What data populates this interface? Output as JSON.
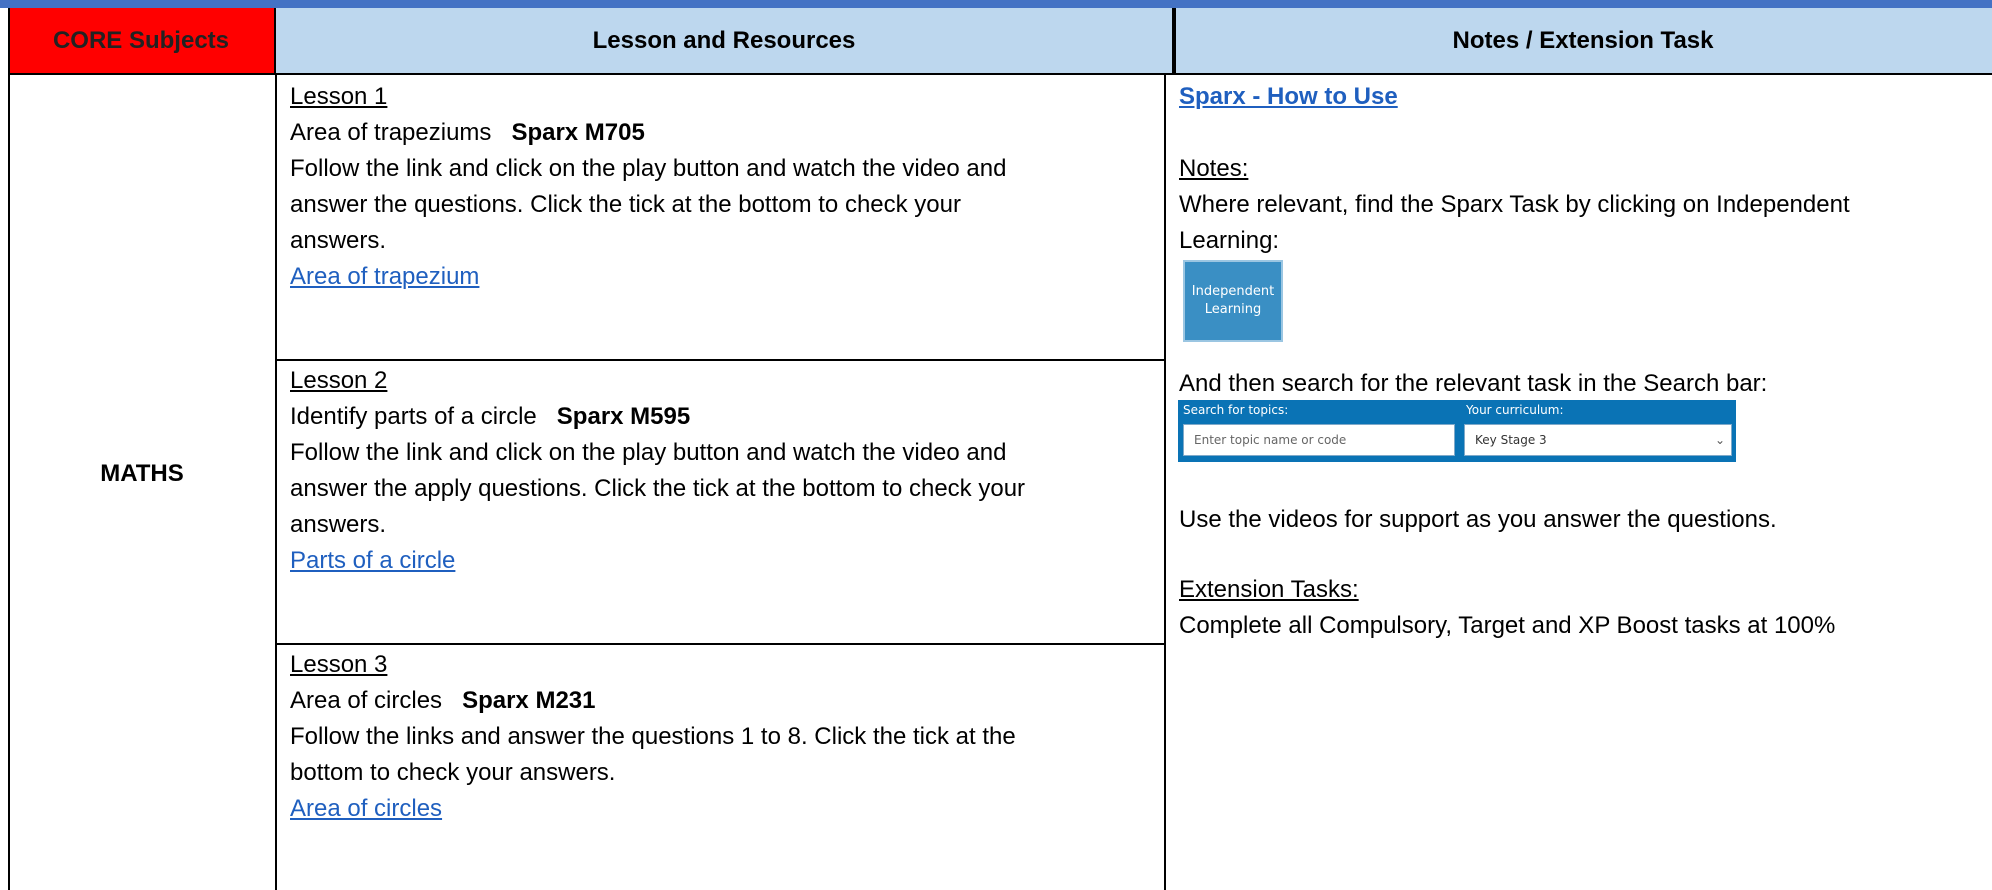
{
  "header": {
    "core": "CORE Subjects",
    "lesson": "Lesson and Resources",
    "notes": "Notes / Extension Task"
  },
  "subject": "MATHS",
  "lessons": [
    {
      "heading": "Lesson 1",
      "topic": "Area of trapeziums",
      "code": "Sparx M705",
      "lines": [
        "Follow the link and click on the play button and watch the video and",
        "answer the questions. Click the tick at the bottom to check your",
        "answers."
      ],
      "link": "Area of trapezium"
    },
    {
      "heading": "Lesson 2",
      "topic": "Identify parts of a circle",
      "code": "Sparx M595",
      "lines": [
        "Follow the link and click on the play button and watch the video and",
        "answer the apply questions. Click the tick at the bottom to check your",
        "answers."
      ],
      "link": "Parts of a circle"
    },
    {
      "heading": "Lesson 3",
      "topic": "Area of circles",
      "code": "Sparx M231",
      "lines": [
        "Follow the links and answer the questions 1 to 8. Click the tick at the",
        "bottom to check your answers."
      ],
      "link": "Area of circles"
    }
  ],
  "notes": {
    "howto_link": "Sparx - How to Use",
    "notes_heading": "Notes:",
    "find_line1": "Where relevant, find the Sparx Task by clicking on Independent",
    "find_line2": "Learning:",
    "tile_line1": "Independent",
    "tile_line2": "Learning",
    "search_line": "And then search for the relevant task in the Search bar:",
    "search_label": "Search for topics:",
    "search_placeholder": "Enter topic name or code",
    "curriculum_label": "Your curriculum:",
    "curriculum_value": "Key Stage 3",
    "videos_line": "Use the videos for support as you answer the questions.",
    "extension_heading": "Extension Tasks:",
    "extension_line": "Complete all Compulsory, Target and XP Boost tasks at 100%"
  }
}
